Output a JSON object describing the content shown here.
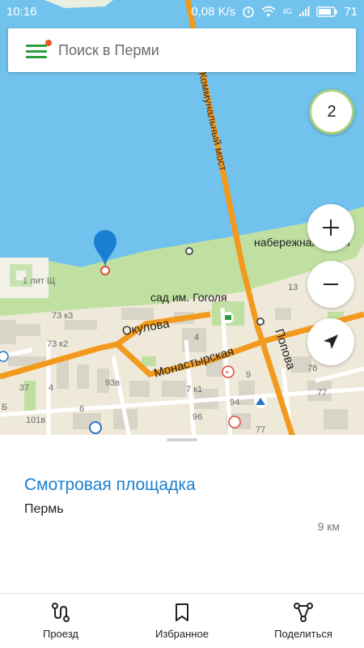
{
  "statusbar": {
    "time": "10:16",
    "speed": "0,08 K/s",
    "net": "4G",
    "battery": "71"
  },
  "search": {
    "placeholder": "Поиск в Перми"
  },
  "map": {
    "layer_count": "2",
    "labels": {
      "bridge": "Коммунальный мост",
      "embankment": "набережная Камы",
      "garden": "сад им. Гоголя",
      "okulova": "Окулова",
      "monastyrskaya": "Монастырская",
      "popova": "Попова",
      "lit": "1 лит Щ",
      "n73k3": "73 к3",
      "n73k2": "73 к2",
      "n37": "37",
      "n4a": "4",
      "n4b": "4",
      "n6": "6",
      "n93v": "93в",
      "n101v": "101в",
      "n7k1": "7 к1",
      "n9": "9",
      "n94": "94",
      "n96": "96",
      "n77a": "77",
      "n77b": "77",
      "n78": "78",
      "n13": "13",
      "nB": "Б"
    },
    "colors": {
      "water": "#72c2ee",
      "park": "#bfe0a0",
      "road": "#f29a1d",
      "land": "#efe9da"
    }
  },
  "place": {
    "title": "Смотровая площадка",
    "city": "Пермь",
    "distance": "9 км"
  },
  "nav": {
    "route": "Проезд",
    "favorites": "Избранное",
    "share": "Поделиться"
  }
}
